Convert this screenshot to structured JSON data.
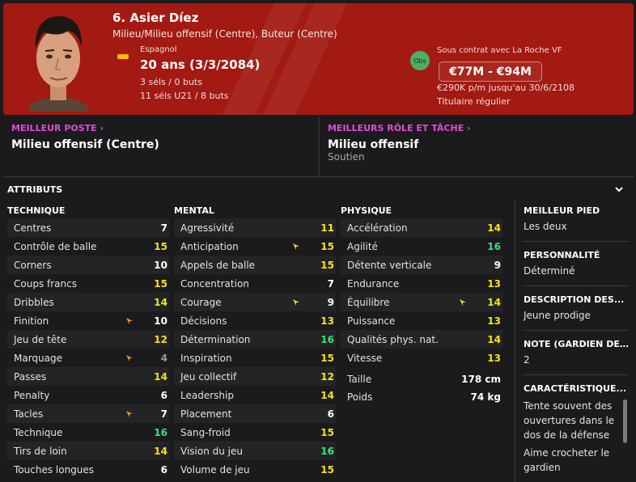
{
  "player": {
    "name": "6. Asier Díez",
    "positions": "Milieu/Milieu offensif (Centre), Buteur (Centre)",
    "nationality": "Espagnol",
    "age": "20 ans (3/3/2084)",
    "caps": "3 séls / 0 buts",
    "u21": "11 séls U21 / 8 buts",
    "obs_label": "Obs",
    "contract_club": "Sous contrat avec La Roche VF",
    "value": "€77M - €94M",
    "wage": "€290K p/m jusqu'au 30/6/2108",
    "status": "Titulaire régulier"
  },
  "roles": {
    "best_position_label": "MEILLEUR POSTE",
    "best_position": "Milieu offensif (Centre)",
    "best_role_label": "MEILLEURS RÔLE ET TÂCHE",
    "best_role": "Milieu offensif",
    "best_role_duty": "Soutien"
  },
  "attributes": {
    "title": "ATTRIBUTS",
    "technique_label": "TECHNIQUE",
    "mental_label": "MENTAL",
    "physique_label": "PHYSIQUE",
    "technique": [
      {
        "name": "Centres",
        "value": "7"
      },
      {
        "name": "Contrôle de balle",
        "value": "15"
      },
      {
        "name": "Corners",
        "value": "10"
      },
      {
        "name": "Coups francs",
        "value": "15"
      },
      {
        "name": "Dribbles",
        "value": "14"
      },
      {
        "name": "Finition",
        "value": "10"
      },
      {
        "name": "Jeu de tête",
        "value": "12"
      },
      {
        "name": "Marquage",
        "value": "4"
      },
      {
        "name": "Passes",
        "value": "14"
      },
      {
        "name": "Penalty",
        "value": "6"
      },
      {
        "name": "Tacles",
        "value": "7"
      },
      {
        "name": "Technique",
        "value": "16"
      },
      {
        "name": "Tirs de loin",
        "value": "14"
      },
      {
        "name": "Touches longues",
        "value": "6"
      }
    ],
    "mental": [
      {
        "name": "Agressivité",
        "value": "11"
      },
      {
        "name": "Anticipation",
        "value": "15"
      },
      {
        "name": "Appels de balle",
        "value": "15"
      },
      {
        "name": "Concentration",
        "value": "7"
      },
      {
        "name": "Courage",
        "value": "9"
      },
      {
        "name": "Décisions",
        "value": "13"
      },
      {
        "name": "Détermination",
        "value": "16"
      },
      {
        "name": "Inspiration",
        "value": "15"
      },
      {
        "name": "Jeu collectif",
        "value": "12"
      },
      {
        "name": "Leadership",
        "value": "14"
      },
      {
        "name": "Placement",
        "value": "6"
      },
      {
        "name": "Sang-froid",
        "value": "15"
      },
      {
        "name": "Vision du jeu",
        "value": "16"
      },
      {
        "name": "Volume de jeu",
        "value": "15"
      }
    ],
    "physique": [
      {
        "name": "Accélération",
        "value": "14"
      },
      {
        "name": "Agilité",
        "value": "16"
      },
      {
        "name": "Détente verticale",
        "value": "9"
      },
      {
        "name": "Endurance",
        "value": "13"
      },
      {
        "name": "Équilibre",
        "value": "14"
      },
      {
        "name": "Puissance",
        "value": "13"
      },
      {
        "name": "Qualités phys. nat.",
        "value": "14"
      },
      {
        "name": "Vitesse",
        "value": "13"
      }
    ],
    "height_label": "Taille",
    "height": "178 cm",
    "weight_label": "Poids",
    "weight": "74 kg"
  },
  "side": {
    "foot_label": "MEILLEUR PIED",
    "foot": "Les deux",
    "personality_label": "PERSONNALITÉ",
    "personality": "Déterminé",
    "description_label": "DESCRIPTION DES...",
    "description": "Jeune prodige",
    "gk_label": "NOTE (GARDIEN DE...",
    "gk": "2",
    "traits_label": "CARACTÉRISTIQUE...",
    "traits": [
      "Tente souvent des ouvertures dans le dos de la défense",
      "Aime crocheter le gardien"
    ]
  },
  "colors": {
    "header": "#a31a12",
    "accent_link": "#e14bd8",
    "value_white": "#ffffff",
    "value_yellow": "#f2e31b",
    "value_green": "#3ee077",
    "value_grey": "#9a9a9a",
    "trend_arrow_orange": "#e89a3c",
    "trend_arrow_yellow": "#e8d93c"
  }
}
